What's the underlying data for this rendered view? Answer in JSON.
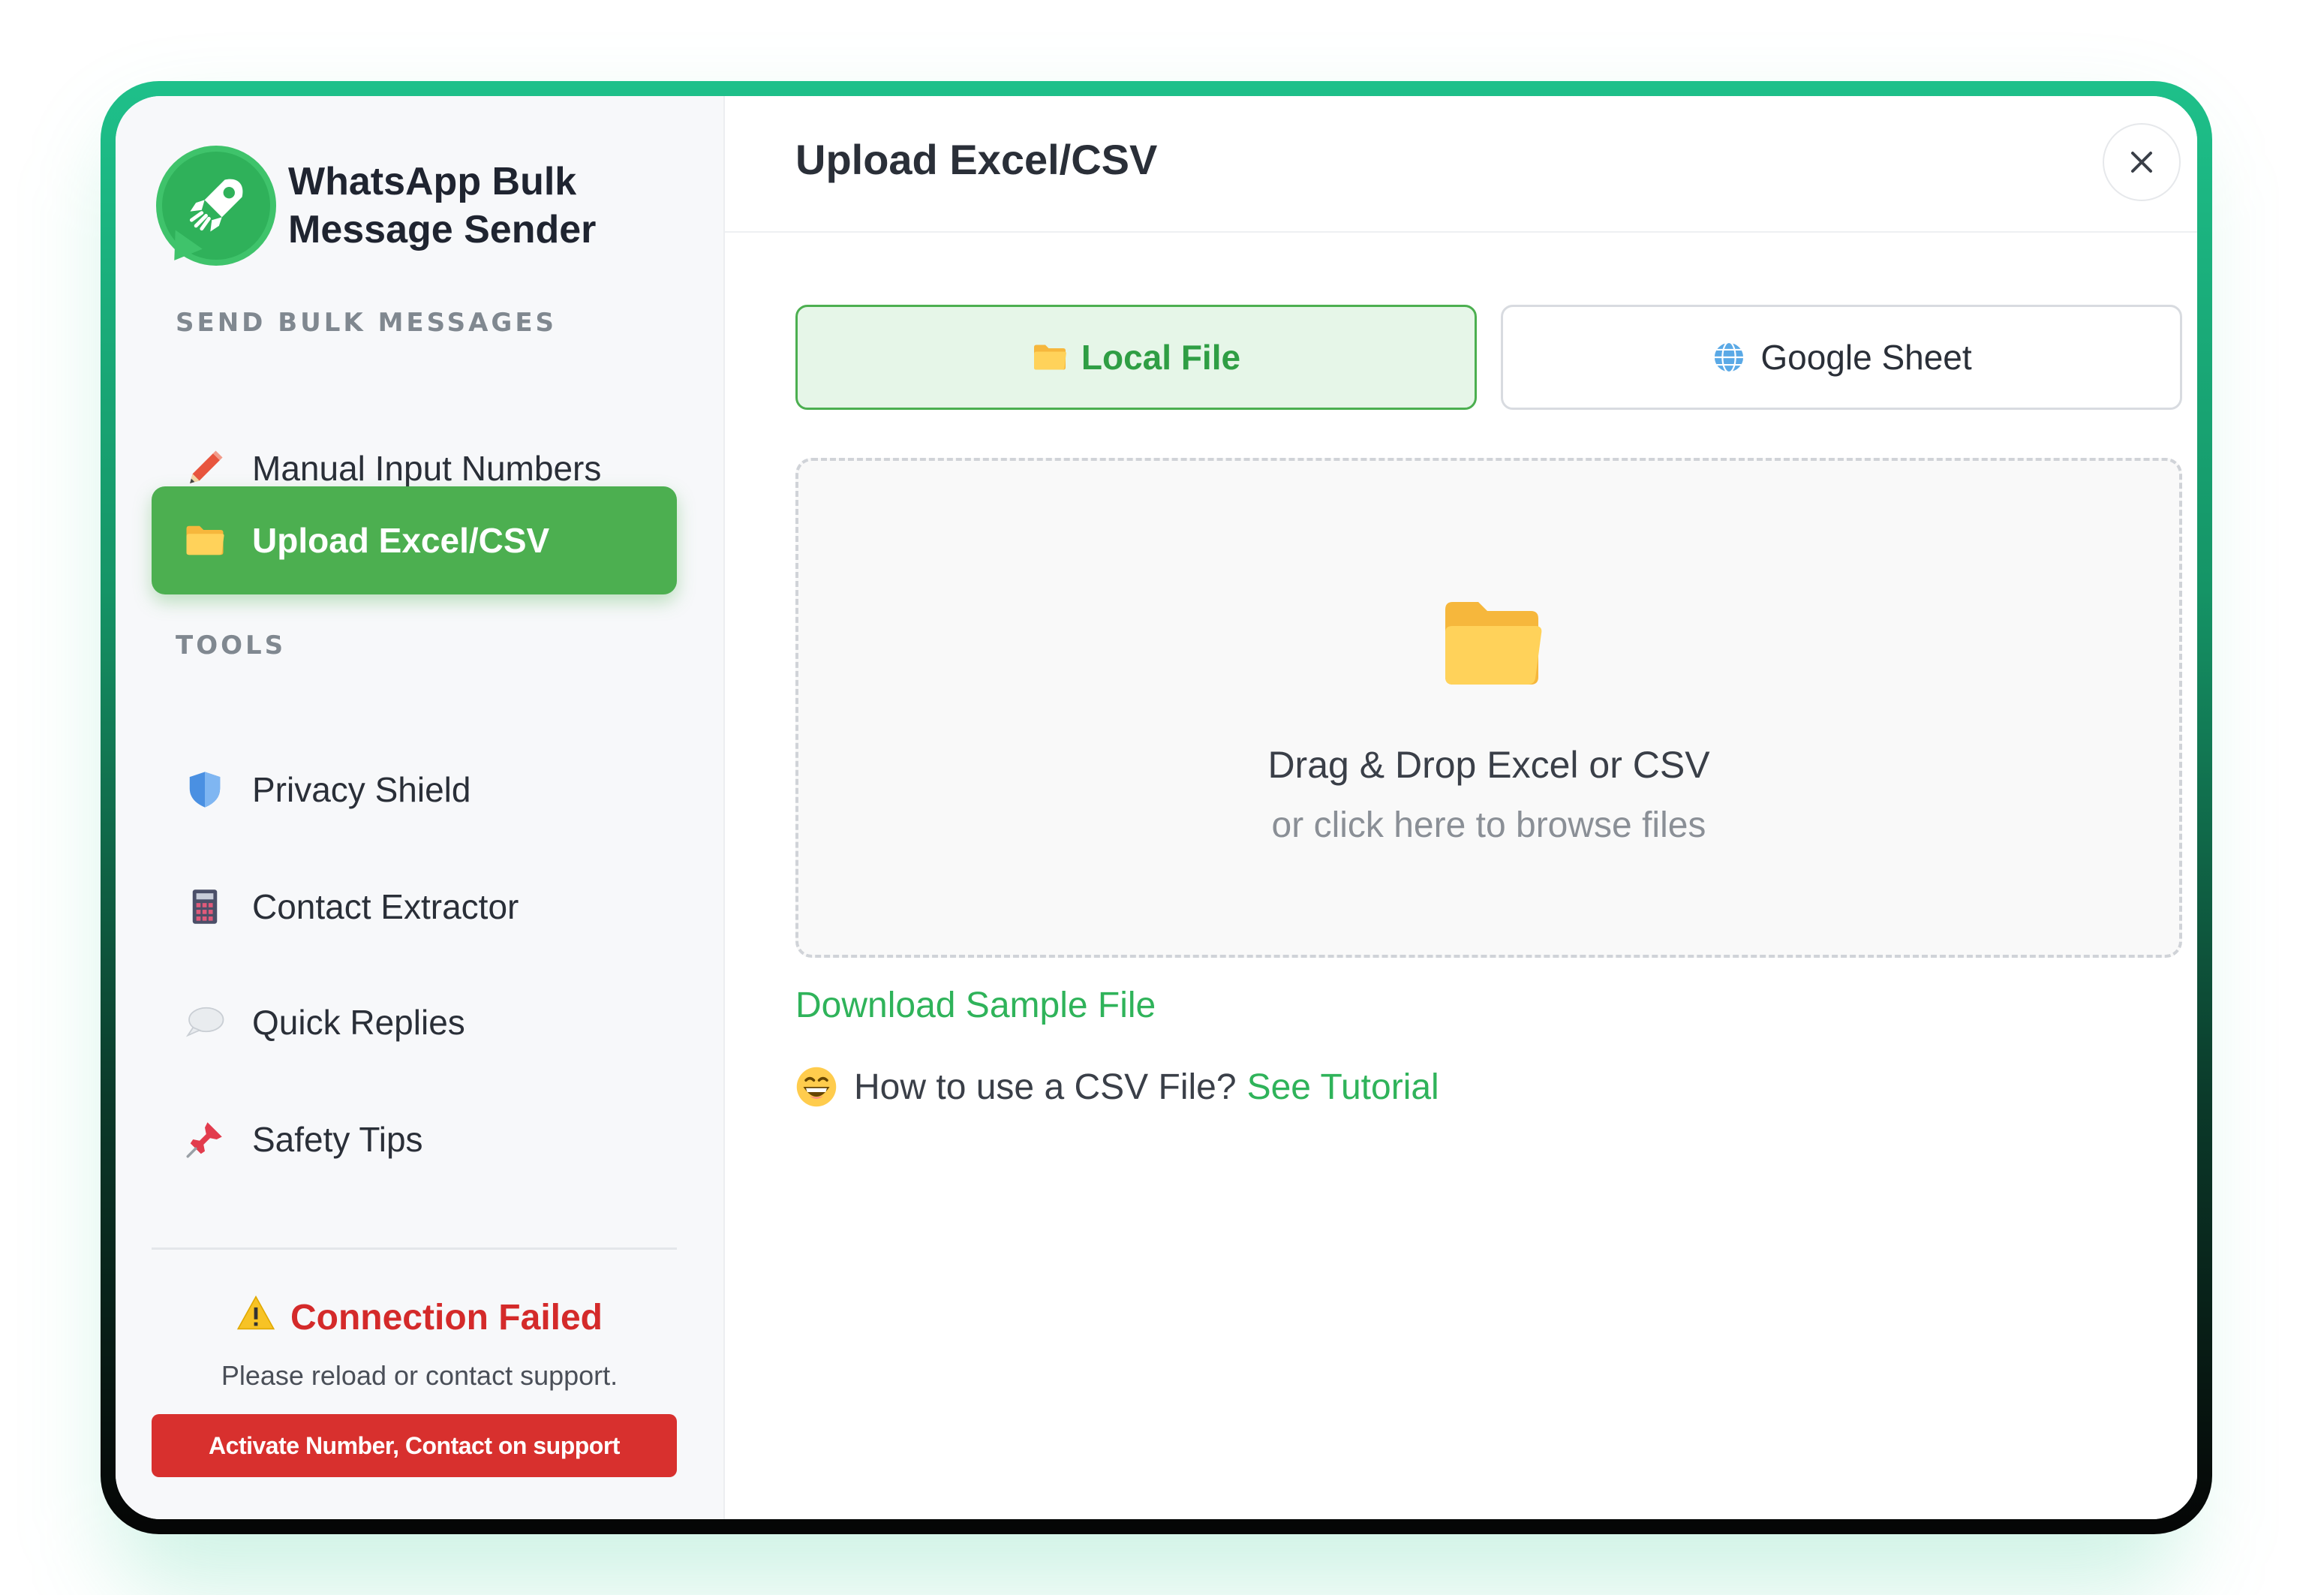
{
  "app": {
    "name": "WhatsApp Bulk Message Sender"
  },
  "sidebar": {
    "section_send": "SEND BULK MESSAGES",
    "section_tools": "TOOLS",
    "items": [
      {
        "label": "Manual Input Numbers",
        "icon": "pencil-icon",
        "active": false
      },
      {
        "label": "Upload Excel/CSV",
        "icon": "folder-icon",
        "active": true
      },
      {
        "label": "Privacy Shield",
        "icon": "shield-icon",
        "active": false
      },
      {
        "label": "Contact Extractor",
        "icon": "calculator-icon",
        "active": false
      },
      {
        "label": "Quick Replies",
        "icon": "speech-bubble-icon",
        "active": false
      },
      {
        "label": "Safety Tips",
        "icon": "pushpin-icon",
        "active": false
      }
    ],
    "status": {
      "title": "Connection Failed",
      "subtitle": "Please reload or contact support.",
      "button": "Activate Number, Contact on support"
    }
  },
  "main": {
    "title": "Upload Excel/CSV",
    "tabs": [
      {
        "label": "Local File",
        "icon": "folder-icon",
        "selected": true
      },
      {
        "label": "Google Sheet",
        "icon": "globe-icon",
        "selected": false
      }
    ],
    "dropzone": {
      "title": "Drag & Drop Excel or CSV",
      "subtitle": "or click here to browse files"
    },
    "sample_link": "Download Sample File",
    "howto": {
      "text": "How to use a CSV File?",
      "link": "See Tutorial"
    }
  },
  "colors": {
    "accent_green": "#4caf50",
    "link_green": "#2fb35a",
    "error_red": "#d42a2a",
    "button_red": "#d8302e"
  }
}
